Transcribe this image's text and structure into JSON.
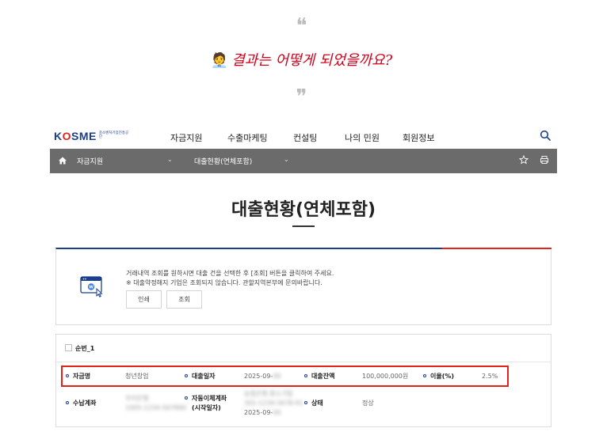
{
  "quote_open": "❝",
  "quote_close": "❞",
  "headline": {
    "emoji": "🧑‍💼",
    "text": "결과는 어떻게 되었을까요?"
  },
  "logo": {
    "brand_k": "K",
    "brand_o": "O",
    "brand_rest": "SME",
    "subtitle": "중소벤처기업진흥공단"
  },
  "menu": [
    {
      "label": "자금지원"
    },
    {
      "label": "수출마케팅"
    },
    {
      "label": "컨설팅"
    },
    {
      "label": "나의 민원"
    },
    {
      "label": "회원정보"
    }
  ],
  "breadcrumb": [
    {
      "label": "자금지원"
    },
    {
      "label": "대출현황(연체포함)"
    }
  ],
  "page_title": "대출현황(연체포함)",
  "info": {
    "line1": "거래내역 조회를 원하시면 대출 건을 선택한 후 [조회] 버튼을 클릭하여 주세요.",
    "line2": "※ 대출약정해지 기업은 조회되지 않습니다. 관할지역본부에 문의바랍니다.",
    "btn_print": "인쇄",
    "btn_inquiry": "조회"
  },
  "loan": {
    "seq_label": "순번_1",
    "fund_name_label": "자금명",
    "fund_name_value": "청년창업",
    "loan_date_label": "대출일자",
    "loan_date_value": "2025-09-",
    "loan_date_hidden": "00",
    "balance_label": "대출잔액",
    "balance_value": "100,000,000원",
    "rate_label": "이율(%)",
    "rate_value": "2.5%",
    "account_label": "수납계좌",
    "account_hidden_1": "우리은행",
    "account_hidden_2": "1005-1234-567890",
    "auto_transfer_label_1": "자동이체계좌",
    "auto_transfer_label_2": "(시작일자)",
    "auto_transfer_hidden_1": "농협은행 중소기업",
    "auto_transfer_hidden_2": "301-1234-5678-91",
    "auto_transfer_date": "2025-09-",
    "auto_transfer_date_hidden": "00",
    "status_label": "상태",
    "status_value": "정상"
  }
}
